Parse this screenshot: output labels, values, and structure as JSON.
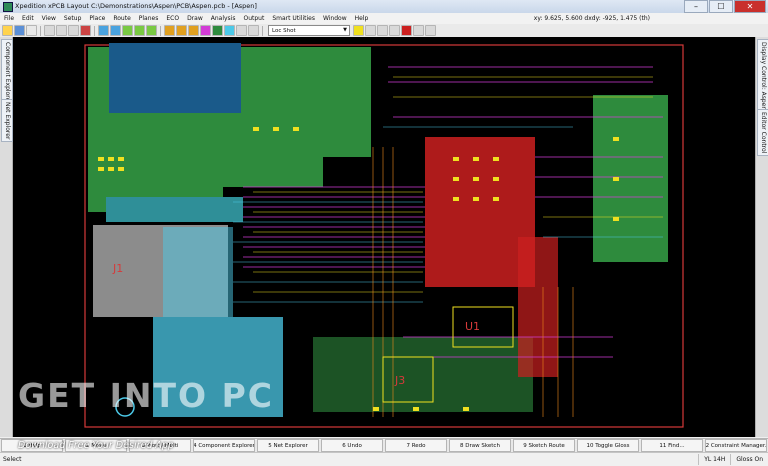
{
  "window": {
    "title": "Xpedition xPCB Layout  C:\\Demonstrations\\Aspen\\PCB\\Aspen.pcb - [Aspen]",
    "min_symbol": "–",
    "max_symbol": "☐",
    "close_symbol": "✕"
  },
  "menu": [
    "File",
    "Edit",
    "View",
    "Setup",
    "Place",
    "Route",
    "Planes",
    "ECO",
    "Draw",
    "Analysis",
    "Output",
    "Smart Utilities",
    "Window",
    "Help"
  ],
  "coordinates": "xy: 9.625, 5.600  dxdy: -925, 1.475  (th)",
  "toolbar": {
    "scheme_select": "Loc Shot"
  },
  "left_panel": {
    "tabs": [
      "Component Explorer",
      "Net Explorer"
    ]
  },
  "right_panel": {
    "tabs": [
      "Display Control: Aspen",
      "Editor Control"
    ]
  },
  "canvas": {
    "colors": {
      "background": "#000000",
      "board_outline": "#d63a3a",
      "green_plane": "#2e8b3d",
      "cyan_plane": "#4cc9e8",
      "magenta_trace": "#d23cd6",
      "yellow_pad": "#f0e020",
      "orange_trace": "#f08a1c",
      "red_area": "#cc2020"
    },
    "labels": [
      "U1",
      "J1",
      "J3"
    ]
  },
  "fkeys": [
    "1 Help",
    "2 Move",
    "3 Plow / Multi",
    "4 Component Explorer",
    "5 Net Explorer",
    "6 Undo",
    "7 Redo",
    "8 Draw Sketch",
    "9 Sketch Route",
    "10 Toggle Gloss",
    "11 Find...",
    "12 Constraint Manager..."
  ],
  "status": {
    "left": "Select",
    "cells": [
      "YL  14H",
      "Gloss On"
    ]
  },
  "watermark": {
    "main": "GET INTO PC",
    "sub": "Download Free Your Desired App"
  }
}
